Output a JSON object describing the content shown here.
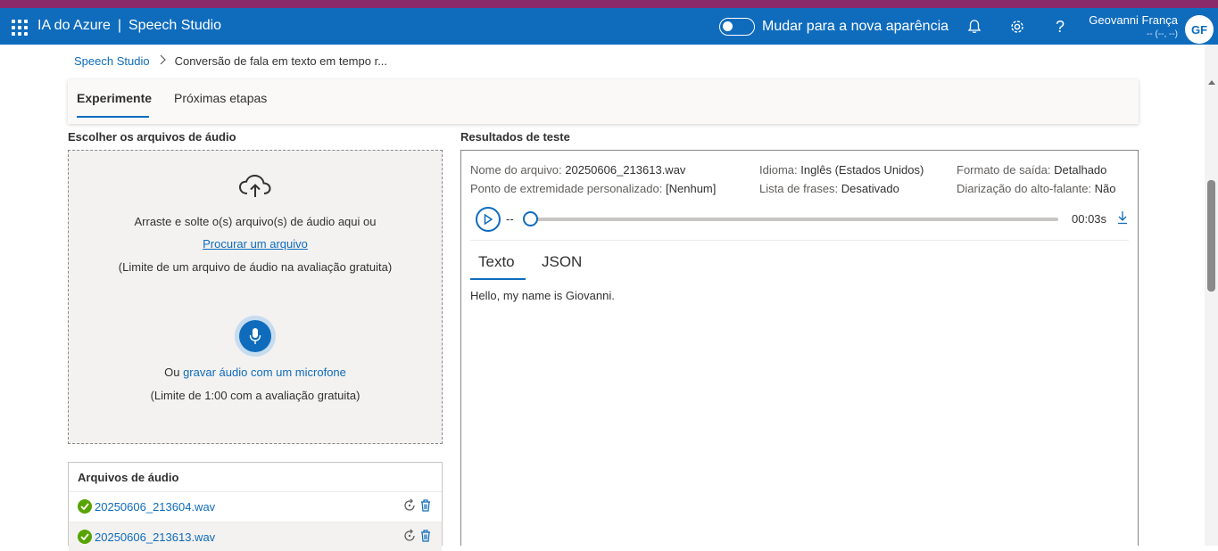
{
  "header": {
    "app_name": "IA do Azure",
    "separator": "|",
    "product": "Speech Studio",
    "toggle_label": "Mudar para a nova aparência",
    "user_name": "Geovanni França",
    "user_sub": "-- (--, --)",
    "avatar_initials": "GF"
  },
  "breadcrumb": {
    "root": "Speech Studio",
    "current": "Conversão de fala em texto em tempo r..."
  },
  "tabs": {
    "experiment": "Experimente",
    "next_steps": "Próximas etapas"
  },
  "upload": {
    "title": "Escolher os arquivos de áudio",
    "drag_text": "Arraste e solte o(s) arquivo(s) de áudio aqui ou",
    "browse_link": "Procurar um arquivo",
    "limit_text": "(Limite de um arquivo de áudio na avaliação gratuita)",
    "record_prefix": "Ou",
    "record_link": "gravar áudio com um microfone",
    "record_limit": "(Limite de 1:00 com a avaliação gratuita)"
  },
  "files": {
    "title": "Arquivos de áudio",
    "items": [
      {
        "name": "20250606_213604.wav",
        "status": "success"
      },
      {
        "name": "20250606_213613.wav",
        "status": "success"
      }
    ]
  },
  "results": {
    "title": "Resultados de teste",
    "file_label": "Nome do arquivo:",
    "file_value": "20250606_213613.wav",
    "endpoint_label": "Ponto de extremidade personalizado:",
    "endpoint_value": "[Nenhum]",
    "language_label": "Idioma:",
    "language_value": "Inglês (Estados Unidos)",
    "phrase_label": "Lista de frases:",
    "phrase_value": "Desativado",
    "format_label": "Formato de saída:",
    "format_value": "Detalhado",
    "diarization_label": "Diarização do alto-falante:",
    "diarization_value": "Não",
    "player_position": "--",
    "duration": "00:03s",
    "tab_text": "Texto",
    "tab_json": "JSON",
    "transcript": "Hello, my name is Giovanni."
  },
  "colors": {
    "accent": "#0f6cbd",
    "top_strip": "#8a2a6b",
    "success": "#57a300"
  }
}
